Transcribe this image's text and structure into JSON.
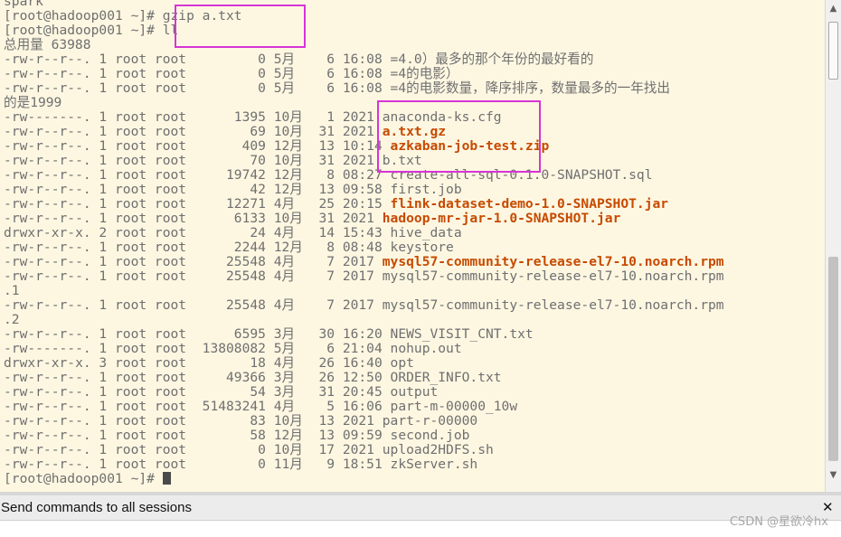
{
  "terminal": {
    "lines": [
      {
        "text": "spark"
      },
      {
        "text": "[root@hadoop001 ~]# gzip a.txt"
      },
      {
        "text": "[root@hadoop001 ~]# ll"
      },
      {
        "text": "总用量 63988"
      },
      {
        "prefix": "-rw-r--r--. 1 root root         0 5月    6 16:08 ",
        "name": "=4.0）最多的那个年份的最好看的"
      },
      {
        "prefix": "-rw-r--r--. 1 root root         0 5月    6 16:08 ",
        "name": "=4的电影）"
      },
      {
        "prefix": "-rw-r--r--. 1 root root         0 5月    6 16:08 ",
        "name": "=4的电影数量，降序排序，数量最多的一年找出"
      },
      {
        "text": "的是1999"
      },
      {
        "prefix": "-rw-------. 1 root root      1395 10月   1 2021 ",
        "name": "anaconda-ks.cfg"
      },
      {
        "prefix": "-rw-r--r--. 1 root root        69 10月  31 2021 ",
        "name": "a.txt.gz",
        "highlight": true
      },
      {
        "prefix": "-rw-r--r--. 1 root root       409 12月  13 10:14 ",
        "name": "azkaban-job-test.zip",
        "highlight": true
      },
      {
        "prefix": "-rw-r--r--. 1 root root        70 10月  31 2021 ",
        "name": "b.txt"
      },
      {
        "prefix": "-rw-r--r--. 1 root root     19742 12月   8 08:27 ",
        "name": "create-all-sql-0.1.0-SNAPSHOT.sql"
      },
      {
        "prefix": "-rw-r--r--. 1 root root        42 12月  13 09:58 ",
        "name": "first.job"
      },
      {
        "prefix": "-rw-r--r--. 1 root root     12271 4月   25 20:15 ",
        "name": "flink-dataset-demo-1.0-SNAPSHOT.jar",
        "highlight": true
      },
      {
        "prefix": "-rw-r--r--. 1 root root      6133 10月  31 2021 ",
        "name": "hadoop-mr-jar-1.0-SNAPSHOT.jar",
        "highlight": true
      },
      {
        "prefix": "drwxr-xr-x. 2 root root        24 4月   14 15:43 ",
        "name": "hive_data"
      },
      {
        "prefix": "-rw-r--r--. 1 root root      2244 12月   8 08:48 ",
        "name": "keystore"
      },
      {
        "prefix": "-rw-r--r--. 1 root root     25548 4月    7 2017 ",
        "name": "mysql57-community-release-el7-10.noarch.rpm",
        "highlight": true
      },
      {
        "prefix": "-rw-r--r--. 1 root root     25548 4月    7 2017 ",
        "name": "mysql57-community-release-el7-10.noarch.rpm"
      },
      {
        "text": ".1"
      },
      {
        "prefix": "-rw-r--r--. 1 root root     25548 4月    7 2017 ",
        "name": "mysql57-community-release-el7-10.noarch.rpm"
      },
      {
        "text": ".2"
      },
      {
        "prefix": "-rw-r--r--. 1 root root      6595 3月   30 16:20 ",
        "name": "NEWS_VISIT_CNT.txt"
      },
      {
        "prefix": "-rw-------. 1 root root  13808082 5月    6 21:04 ",
        "name": "nohup.out"
      },
      {
        "prefix": "drwxr-xr-x. 3 root root        18 4月   26 16:40 ",
        "name": "opt"
      },
      {
        "prefix": "-rw-r--r--. 1 root root     49366 3月   26 12:50 ",
        "name": "ORDER_INFO.txt"
      },
      {
        "prefix": "-rw-r--r--. 1 root root        54 3月   31 20:45 ",
        "name": "output"
      },
      {
        "prefix": "-rw-r--r--. 1 root root  51483241 4月    5 16:06 ",
        "name": "part-m-00000_10w"
      },
      {
        "prefix": "-rw-r--r--. 1 root root        83 10月  13 2021 ",
        "name": "part-r-00000"
      },
      {
        "prefix": "-rw-r--r--. 1 root root        58 12月  13 09:59 ",
        "name": "second.job"
      },
      {
        "prefix": "-rw-r--r--. 1 root root         0 10月  17 2021 ",
        "name": "upload2HDFS.sh"
      },
      {
        "prefix": "-rw-r--r--. 1 root root         0 11月   9 18:51 ",
        "name": "zkServer.sh"
      },
      {
        "text": "[root@hadoop001 ~]# ",
        "cursor": true
      }
    ]
  },
  "send_bar": {
    "label": "Send commands to all sessions",
    "close": "✕"
  },
  "scrollbar": {
    "up_icon": "▲",
    "down_icon": "▼"
  },
  "watermark": "CSDN @星欲冷hx",
  "colors": {
    "terminal_bg": "#fdf7e2",
    "text": "#6f6f6f",
    "highlight_file": "#c74a00",
    "annotation_box": "#d635d6"
  }
}
